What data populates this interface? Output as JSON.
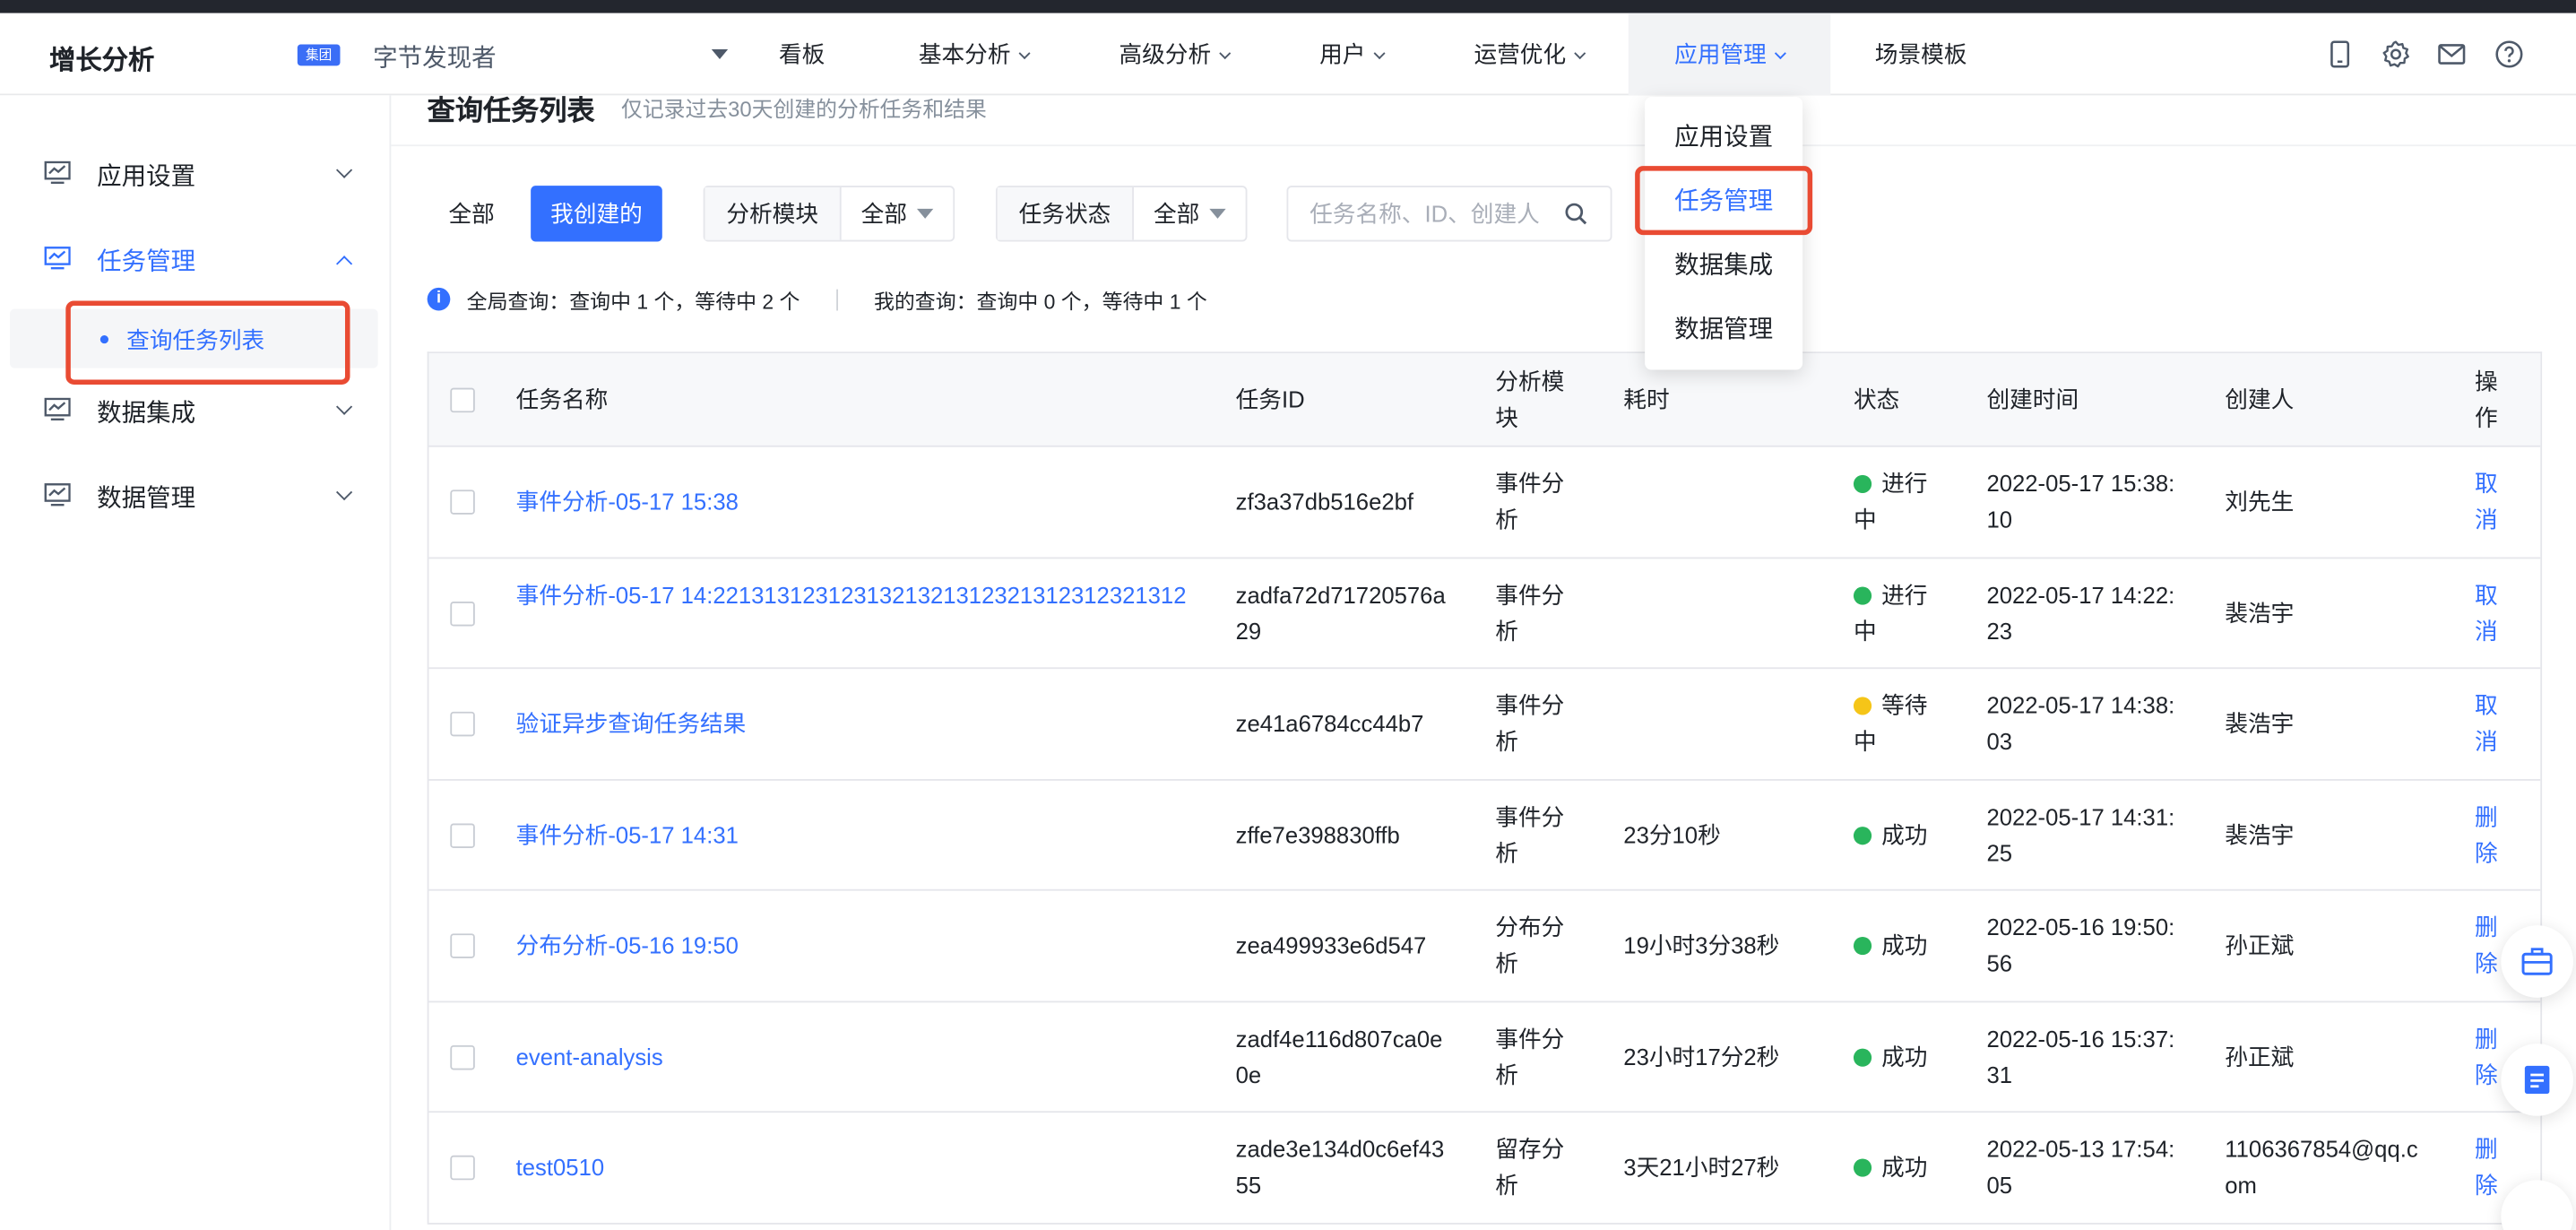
{
  "header": {
    "brand": "增长分析",
    "project_badge": "集团",
    "project_name": "字节发现者",
    "nav": [
      {
        "label": "看板"
      },
      {
        "label": "基本分析"
      },
      {
        "label": "高级分析"
      },
      {
        "label": "用户"
      },
      {
        "label": "运营优化"
      },
      {
        "label": "应用管理"
      },
      {
        "label": "场景模板"
      }
    ],
    "icons": [
      "mobile-icon",
      "gear-icon",
      "mail-icon",
      "help-icon"
    ]
  },
  "dropdown": {
    "items": [
      {
        "label": "应用设置"
      },
      {
        "label": "任务管理"
      },
      {
        "label": "数据集成"
      },
      {
        "label": "数据管理"
      }
    ]
  },
  "sidebar": {
    "items": [
      {
        "label": "应用设置"
      },
      {
        "label": "任务管理"
      },
      {
        "label": "数据集成"
      },
      {
        "label": "数据管理"
      }
    ],
    "sub_item": "查询任务列表"
  },
  "page": {
    "title": "查询任务列表",
    "subtitle": "仅记录过去30天创建的分析任务和结果"
  },
  "filters": {
    "seg_all": "全部",
    "seg_mine": "我创建的",
    "module_label": "分析模块",
    "module_value": "全部",
    "status_label": "任务状态",
    "status_value": "全部",
    "search_placeholder": "任务名称、ID、创建人"
  },
  "info": {
    "global": "全局查询：查询中 1 个，等待中 2 个",
    "mine": "我的查询：查询中 0 个，等待中 1 个"
  },
  "table": {
    "headers": {
      "name": "任务名称",
      "id": "任务ID",
      "module_1": "分析模",
      "module_2": "块",
      "duration": "耗时",
      "status": "状态",
      "created": "创建时间",
      "creator": "创建人",
      "op_1": "操",
      "op_2": "作"
    },
    "rows": [
      {
        "name_1": "事件分析-05-17 15:38",
        "name_2": "",
        "id_1": "zf3a37db516e2bf",
        "id_2": "",
        "mod_1": "事件分",
        "mod_2": "析",
        "duration": "",
        "status_1": "进行",
        "status_2": "中",
        "status_type": "run",
        "time_1": "2022-05-17 15:38:",
        "time_2": "10",
        "creator_1": "刘先生",
        "creator_2": "",
        "op_1": "取",
        "op_2": "消"
      },
      {
        "name_1": "事件分析-05-17 14:2213131231231321321312321312312321312",
        "name_2": "",
        "id_1": "zadfa72d71720576a",
        "id_2": "29",
        "mod_1": "事件分",
        "mod_2": "析",
        "duration": "",
        "status_1": "进行",
        "status_2": "中",
        "status_type": "run",
        "time_1": "2022-05-17 14:22:",
        "time_2": "23",
        "creator_1": "裴浩宇",
        "creator_2": "",
        "op_1": "取",
        "op_2": "消"
      },
      {
        "name_1": "验证异步查询任务结果",
        "name_2": "",
        "id_1": "ze41a6784cc44b7",
        "id_2": "",
        "mod_1": "事件分",
        "mod_2": "析",
        "duration": "",
        "status_1": "等待",
        "status_2": "中",
        "status_type": "wait",
        "time_1": "2022-05-17 14:38:",
        "time_2": "03",
        "creator_1": "裴浩宇",
        "creator_2": "",
        "op_1": "取",
        "op_2": "消"
      },
      {
        "name_1": "事件分析-05-17 14:31",
        "name_2": "",
        "id_1": "zffe7e398830ffb",
        "id_2": "",
        "mod_1": "事件分",
        "mod_2": "析",
        "duration": "23分10秒",
        "status_1": "成功",
        "status_2": "",
        "status_type": "ok",
        "time_1": "2022-05-17 14:31:",
        "time_2": "25",
        "creator_1": "裴浩宇",
        "creator_2": "",
        "op_1": "删",
        "op_2": "除"
      },
      {
        "name_1": "分布分析-05-16 19:50",
        "name_2": "",
        "id_1": "zea499933e6d547",
        "id_2": "",
        "mod_1": "分布分",
        "mod_2": "析",
        "duration": "19小时3分38秒",
        "status_1": "成功",
        "status_2": "",
        "status_type": "ok",
        "time_1": "2022-05-16 19:50:",
        "time_2": "56",
        "creator_1": "孙正斌",
        "creator_2": "",
        "op_1": "删",
        "op_2": "除"
      },
      {
        "name_1": "event-analysis",
        "name_2": "",
        "id_1": "zadf4e116d807ca0e",
        "id_2": "0e",
        "mod_1": "事件分",
        "mod_2": "析",
        "duration": "23小时17分2秒",
        "status_1": "成功",
        "status_2": "",
        "status_type": "ok",
        "time_1": "2022-05-16 15:37:",
        "time_2": "31",
        "creator_1": "孙正斌",
        "creator_2": "",
        "op_1": "删",
        "op_2": "除"
      },
      {
        "name_1": "test0510",
        "name_2": "",
        "id_1": "zade3e134d0c6ef43",
        "id_2": "55",
        "mod_1": "留存分",
        "mod_2": "析",
        "duration": "3天21小时27秒",
        "status_1": "成功",
        "status_2": "",
        "status_type": "ok",
        "time_1": "2022-05-13 17:54:",
        "time_2": "05",
        "creator_1": "1106367854@qq.c",
        "creator_2": "om",
        "op_1": "删",
        "op_2": "除"
      }
    ]
  },
  "colors": {
    "accent": "#3370ff",
    "highlight_box": "#e94b33",
    "status_running": "#29b55c",
    "status_waiting": "#f5c518",
    "status_success": "#29b55c"
  }
}
